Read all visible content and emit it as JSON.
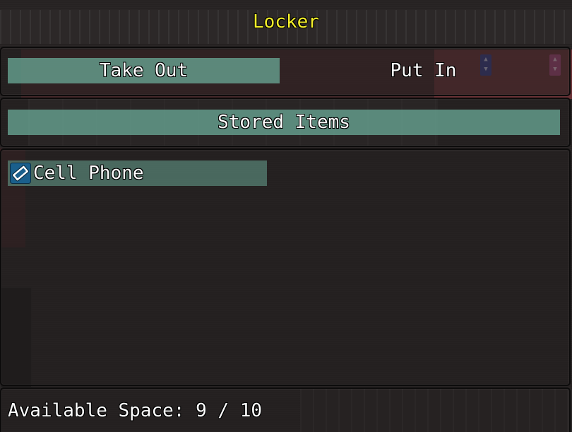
{
  "window": {
    "title": "Locker"
  },
  "commands": [
    {
      "label": "Take Out",
      "selected": true
    },
    {
      "label": "Put In",
      "selected": false
    }
  ],
  "list_header": "Stored Items",
  "items": [
    {
      "name": "Cell Phone",
      "icon": "card-icon",
      "selected": true
    }
  ],
  "footer": {
    "available_space": "Available Space: 9 / 10"
  },
  "colors": {
    "title": "#f5f02a",
    "text": "#ffffff",
    "highlight": "#6eb09c",
    "window_border": "#0c0b0b"
  }
}
